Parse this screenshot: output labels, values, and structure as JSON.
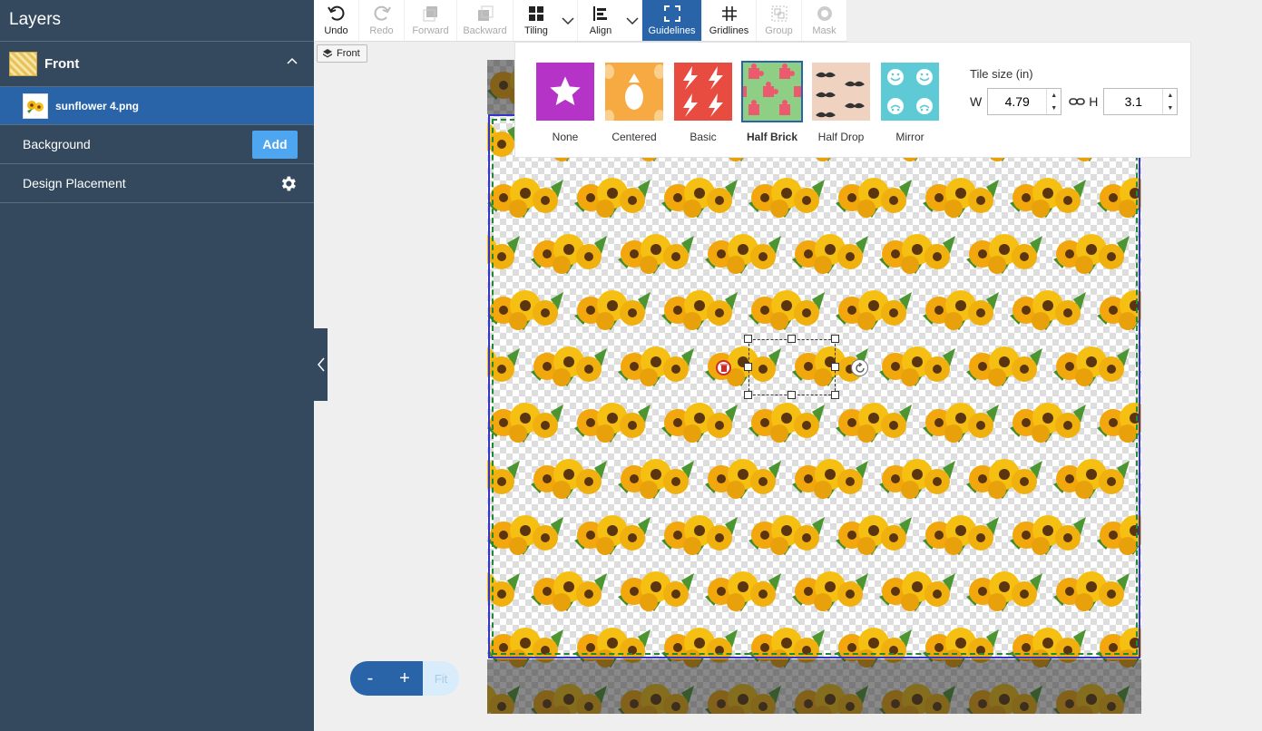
{
  "sidebar": {
    "title": "Layers",
    "group": {
      "label": "Front"
    },
    "layer": {
      "label": "sunflower 4.png"
    },
    "background": {
      "label": "Background",
      "add_label": "Add"
    },
    "placement": {
      "label": "Design Placement"
    }
  },
  "toolbar": {
    "undo": "Undo",
    "redo": "Redo",
    "forward": "Forward",
    "backward": "Backward",
    "tiling": "Tiling",
    "align": "Align",
    "guidelines": "Guidelines",
    "gridlines": "Gridlines",
    "group": "Group",
    "mask": "Mask"
  },
  "side_chip": "Front",
  "tiling": {
    "options": [
      "None",
      "Centered",
      "Basic",
      "Half Brick",
      "Half Drop",
      "Mirror"
    ],
    "selected": "Half Brick",
    "tile_size_label": "Tile size (in)",
    "w_label": "W",
    "h_label": "H",
    "w_value": "4.79",
    "h_value": "3.1"
  },
  "zoom": {
    "minus": "-",
    "plus": "+",
    "fit": "Fit"
  },
  "colors": {
    "accent": "#2a64a8",
    "sidebar": "#34495e",
    "add": "#4ea6f0"
  }
}
